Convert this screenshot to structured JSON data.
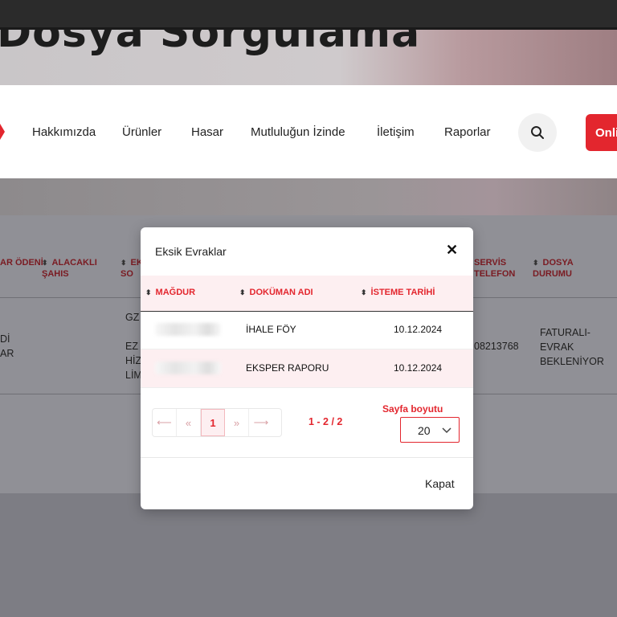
{
  "hero": {
    "title": "Dosya Sorgulama"
  },
  "nav": {
    "items": [
      "Hakkımızda",
      "Ürünler",
      "Hasar",
      "Mutluluğun İzinde",
      "İletişim",
      "Raporlar"
    ],
    "online_label": "Onli",
    "icons": {
      "search": "search-icon"
    }
  },
  "background_table": {
    "headers": [
      "AR ÖDENİ",
      "ALACAKLI ŞAHIS",
      "EK SO",
      "SERVİS TELEFON",
      "DOSYA DURUMU"
    ],
    "row": {
      "col1_line1": "Dİ",
      "col1_line2": "AR",
      "col3_line1": "GZ",
      "col3_line2": "EZ",
      "col3_line3": "HİZ",
      "col3_line4": "LİM",
      "phone": "08213768",
      "status_line1": "FATURALI-",
      "status_line2": "EVRAK",
      "status_line3": "BEKLENİYOR"
    }
  },
  "modal": {
    "title": "Eksik Evraklar",
    "close_icon": "close-icon",
    "columns": [
      "MAĞDUR",
      "DOKÜMAN ADI",
      "İSTEME TARİHİ"
    ],
    "rows": [
      {
        "document": "İHALE FÖY",
        "date": "10.12.2024"
      },
      {
        "document": "EKSPER RAPORU",
        "date": "10.12.2024"
      }
    ],
    "pagination": {
      "first": "⟵",
      "prev": "«",
      "current": "1",
      "next": "»",
      "last": "⟶",
      "range": "1 - 2 / 2"
    },
    "page_size": {
      "label": "Sayfa boyutu",
      "value": "20"
    },
    "close_label": "Kapat"
  },
  "colors": {
    "accent": "#e3262e",
    "row_alt": "#fdeff1"
  }
}
